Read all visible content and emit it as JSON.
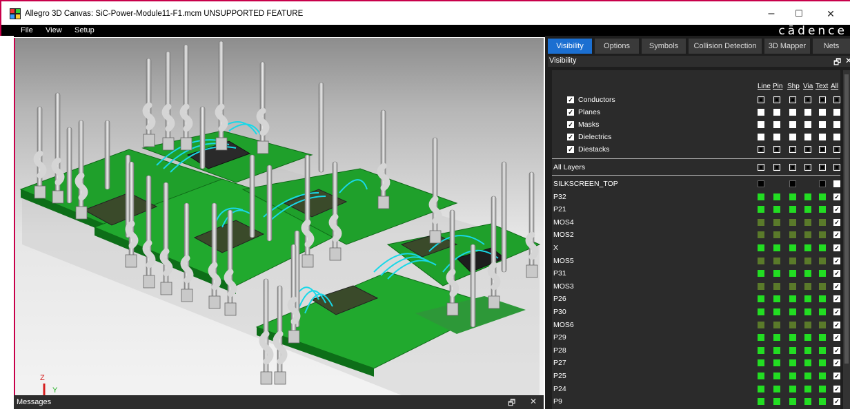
{
  "window": {
    "title": "Allegro 3D Canvas: SiC-Power-Module11-F1.mcm  UNSUPPORTED FEATURE",
    "minimize": "–",
    "maximize": "☐",
    "close": "✕"
  },
  "menu": {
    "items": [
      "File",
      "View",
      "Setup"
    ],
    "brand": "cādence"
  },
  "viewport": {
    "axes": {
      "z": "Z",
      "y": "Y",
      "x": "X"
    }
  },
  "messages": {
    "title": "Messages",
    "float": "🗗",
    "close": "✕"
  },
  "panel": {
    "tabs": [
      "Visibility",
      "Options",
      "Symbols",
      "Collision Detection",
      "3D Mapper",
      "Nets"
    ],
    "active_tab": "Visibility",
    "header": "Visibility",
    "header_float": "🗗",
    "header_close": "✕",
    "columns": [
      "Line",
      "Pin",
      "Shp",
      "Via",
      "Text",
      "All"
    ],
    "categories": [
      {
        "label": "Conductors",
        "checked": true,
        "style": "hollow"
      },
      {
        "label": "Planes",
        "checked": true,
        "style": "white"
      },
      {
        "label": "Masks",
        "checked": true,
        "style": "white"
      },
      {
        "label": "Dielectrics",
        "checked": true,
        "style": "white"
      },
      {
        "label": "Diestacks",
        "checked": true,
        "style": "hollow"
      }
    ],
    "all_layers": "All Layers",
    "layers": [
      {
        "name": "SILKSCREEN_TOP",
        "color": "#000000",
        "all": "white"
      },
      {
        "name": "P32",
        "color": "#22dd22",
        "all": "check"
      },
      {
        "name": "P21",
        "color": "#22dd22",
        "all": "check"
      },
      {
        "name": "MOS4",
        "color": "#5a7a2a",
        "all": "check"
      },
      {
        "name": "MOS2",
        "color": "#5a7a2a",
        "all": "check"
      },
      {
        "name": "X",
        "color": "#22dd22",
        "all": "check"
      },
      {
        "name": "MOS5",
        "color": "#5a7a2a",
        "all": "check"
      },
      {
        "name": "P31",
        "color": "#22dd22",
        "all": "check"
      },
      {
        "name": "MOS3",
        "color": "#5a7a2a",
        "all": "check"
      },
      {
        "name": "P26",
        "color": "#22dd22",
        "all": "check"
      },
      {
        "name": "P30",
        "color": "#22dd22",
        "all": "check"
      },
      {
        "name": "MOS6",
        "color": "#5a7a2a",
        "all": "check"
      },
      {
        "name": "P29",
        "color": "#22dd22",
        "all": "check"
      },
      {
        "name": "P28",
        "color": "#22dd22",
        "all": "check"
      },
      {
        "name": "P27",
        "color": "#22dd22",
        "all": "check"
      },
      {
        "name": "P25",
        "color": "#22dd22",
        "all": "check"
      },
      {
        "name": "P24",
        "color": "#22dd22",
        "all": "check"
      },
      {
        "name": "P9",
        "color": "#22dd22",
        "all": "check"
      }
    ]
  }
}
